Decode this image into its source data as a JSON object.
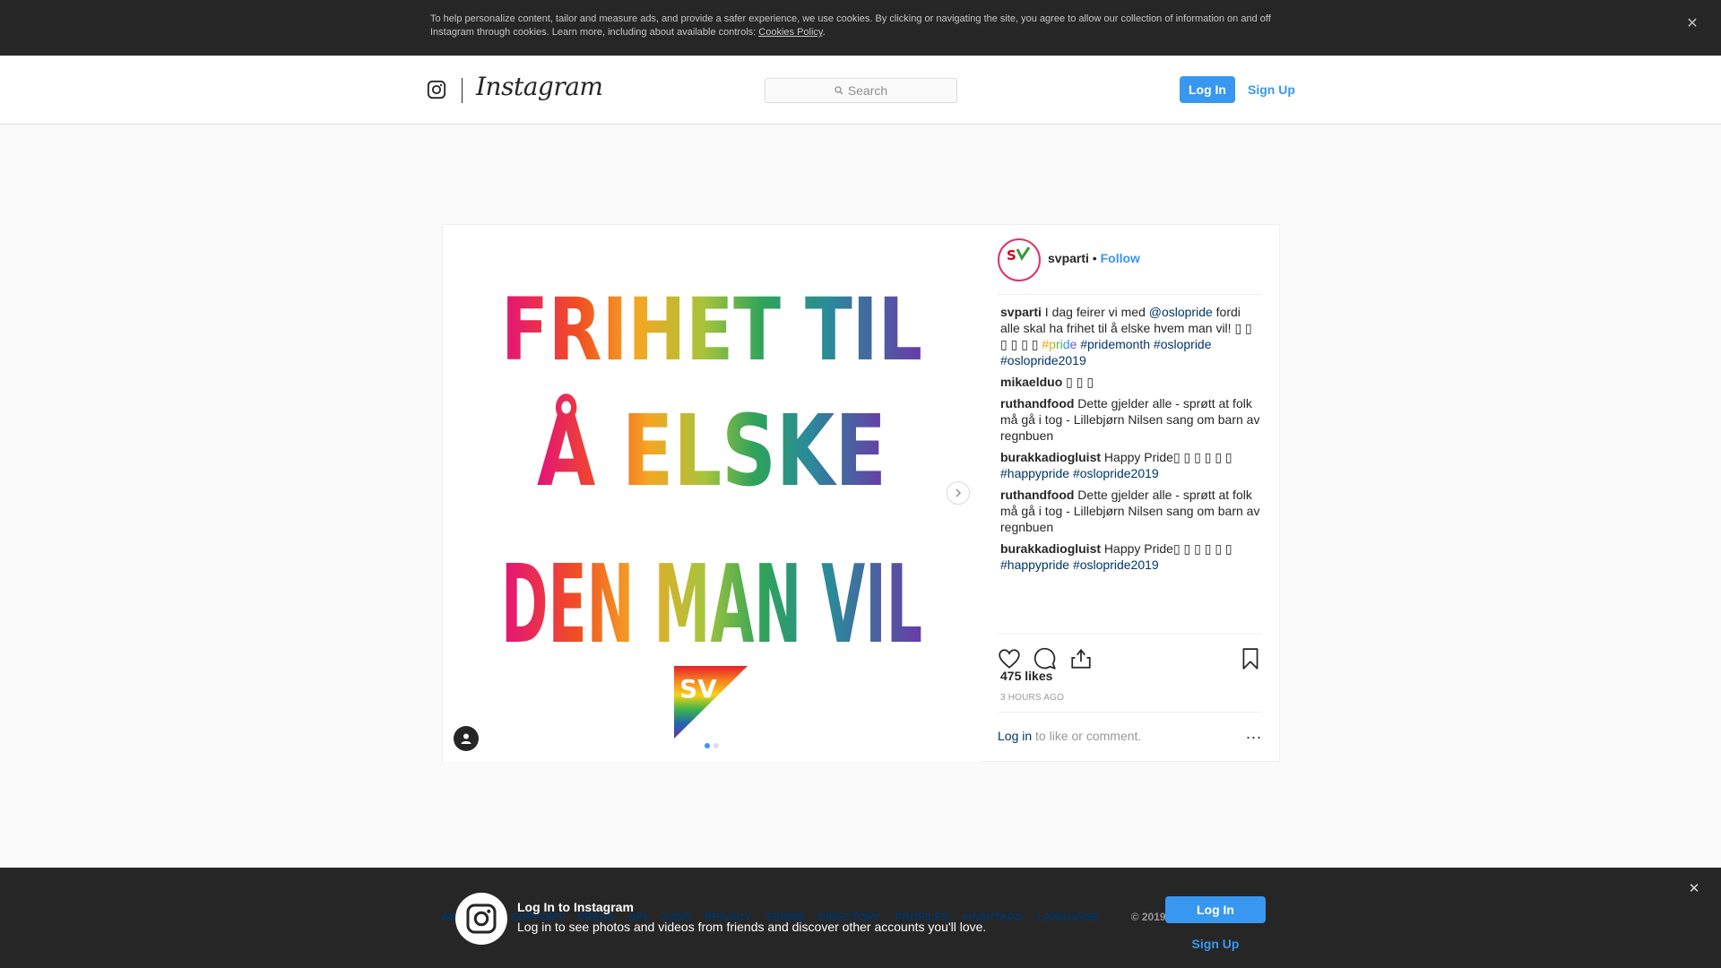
{
  "cookie_bar": {
    "text": "To help personalize content, tailor and measure ads, and provide a safer experience, we use cookies. By clicking or navigating the site, you agree to allow our collection of information on and off Instagram through cookies. Learn more, including about available controls: ",
    "link": "Cookies Policy",
    "suffix": ".",
    "close_icon": "close-icon"
  },
  "header": {
    "wordmark": "Instagram",
    "search_placeholder": "Search",
    "login_label": "Log In",
    "signup_label": "Sign Up"
  },
  "post": {
    "image_text": {
      "line1": "FRIHET TIL",
      "line2": "Å ELSKE",
      "line3": "DEN MAN VIL",
      "logo": "SV"
    },
    "carousel_dots": 2,
    "author": "svparti",
    "separator": " • ",
    "follow_label": "Follow",
    "comments": [
      {
        "user": "svparti",
        "parts": [
          {
            "t": "text",
            "v": " I dag feirer vi med "
          },
          {
            "t": "tag",
            "v": "@oslopride"
          },
          {
            "t": "text",
            "v": " fordi alle skal ha frihet til å elske hvem man vil! ▯ ▯ ▯ ▯ ▯ ▯ "
          },
          {
            "t": "pride",
            "v": "#pride"
          },
          {
            "t": "text",
            "v": " "
          },
          {
            "t": "tag",
            "v": "#pridemonth"
          },
          {
            "t": "text",
            "v": " "
          },
          {
            "t": "tag",
            "v": "#oslopride"
          },
          {
            "t": "text",
            "v": " "
          },
          {
            "t": "tag",
            "v": "#oslopride2019"
          }
        ]
      },
      {
        "user": "mikaelduo",
        "parts": [
          {
            "t": "text",
            "v": " ▯ ▯ ▯"
          }
        ]
      },
      {
        "user": "ruthandfood",
        "parts": [
          {
            "t": "text",
            "v": " Dette gjelder alle - sprøtt at folk må gå i tog - Lillebjørn Nilsen sang om barn av regnbuen"
          }
        ]
      },
      {
        "user": "burakkadiogluist",
        "parts": [
          {
            "t": "text",
            "v": " Happy Pride▯ ▯ ▯ ▯ ▯ ▯ "
          },
          {
            "t": "tag",
            "v": "#happypride"
          },
          {
            "t": "text",
            "v": " "
          },
          {
            "t": "tag",
            "v": "#oslopride2019"
          }
        ]
      },
      {
        "user": "ruthandfood",
        "parts": [
          {
            "t": "text",
            "v": " Dette gjelder alle - sprøtt at folk må gå i tog - Lillebjørn Nilsen sang om barn av regnbuen"
          }
        ]
      },
      {
        "user": "burakkadiogluist",
        "parts": [
          {
            "t": "text",
            "v": " Happy Pride▯ ▯ ▯ ▯ ▯ ▯ "
          },
          {
            "t": "tag",
            "v": "#happypride"
          },
          {
            "t": "text",
            "v": " "
          },
          {
            "t": "tag",
            "v": "#oslopride2019"
          }
        ]
      }
    ],
    "likes": "475 likes",
    "time": "3 HOURS AGO",
    "login_link": "Log in",
    "login_suffix": " to like or comment.",
    "more_label": "...",
    "icons": [
      "heart-icon",
      "comment-icon",
      "share-icon",
      "bookmark-icon"
    ]
  },
  "footer": {
    "links": [
      "ABOUT US",
      "SUPPORT",
      "PRESS",
      "API",
      "JOBS",
      "PRIVACY",
      "TERMS",
      "DIRECTORY",
      "PROFILES",
      "HASHTAGS",
      "LANGUAGE"
    ],
    "copyright": "© 2019 INSTAGRAM"
  },
  "login_banner": {
    "title": "Log In to Instagram",
    "subtitle": "Log in to see photos and videos from friends and discover other accounts you'll love.",
    "login_label": "Log In",
    "signup_label": "Sign Up"
  },
  "colors": {
    "accent": "#3897f0",
    "link": "#003569",
    "dark_bar": "#262626"
  }
}
